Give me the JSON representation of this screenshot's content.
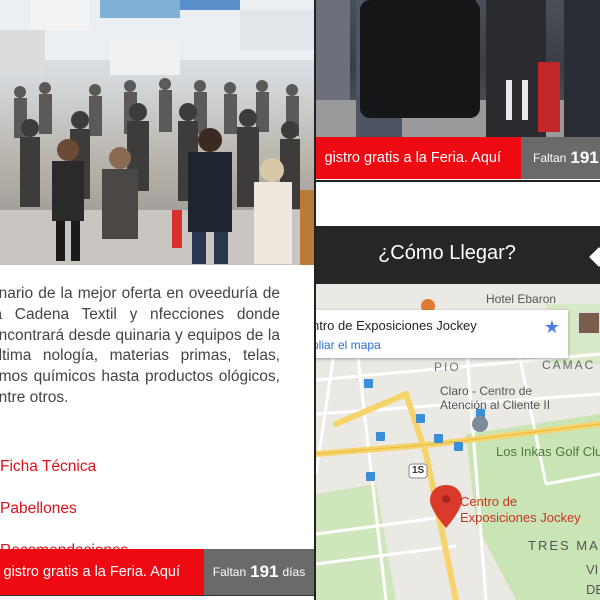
{
  "left": {
    "description": "enario de la mejor oferta en oveeduría de la Cadena Textil y nfecciones donde encontrará desde quinaria y equipos de la última nología, materias primas, telas, umos químicos hasta productos ológicos, entre otros.",
    "links": [
      "Ficha Técnica",
      "Pabellones",
      "Recomendaciones"
    ],
    "cta": {
      "register_text": "gistro gratis a la Feria. Aquí",
      "countdown_prefix": "Faltan",
      "countdown_days": "191",
      "countdown_suffix": "días"
    }
  },
  "top_right": {
    "cta": {
      "register_text": "gistro gratis a la Feria. Aquí",
      "countdown_prefix": "Faltan",
      "countdown_days": "191"
    }
  },
  "map_section": {
    "title": "¿Cómo Llegar?",
    "place_name": "ntro de Exposiciones Jockey",
    "enlarge_link": "pliar el mapa",
    "labels": {
      "hotel": "Hotel Ebaron",
      "camac": "CAMAC",
      "pio": "PIO",
      "claro": "Claro - Centro de",
      "claro2": "Atención al Cliente II",
      "golf": "Los Inkas Golf Clu",
      "route": "1S",
      "marker_line1": "Centro de",
      "marker_line2": "Exposiciones Jockey",
      "tres_mar": "TRES MAR",
      "vi": "VI",
      "de": "DE"
    }
  },
  "colors": {
    "accent_red": "#ee0a12",
    "link_red": "#e0101a",
    "countdown_grey": "#6a6a6a",
    "header_dark": "#262626",
    "map_marker": "#d93a2b"
  }
}
